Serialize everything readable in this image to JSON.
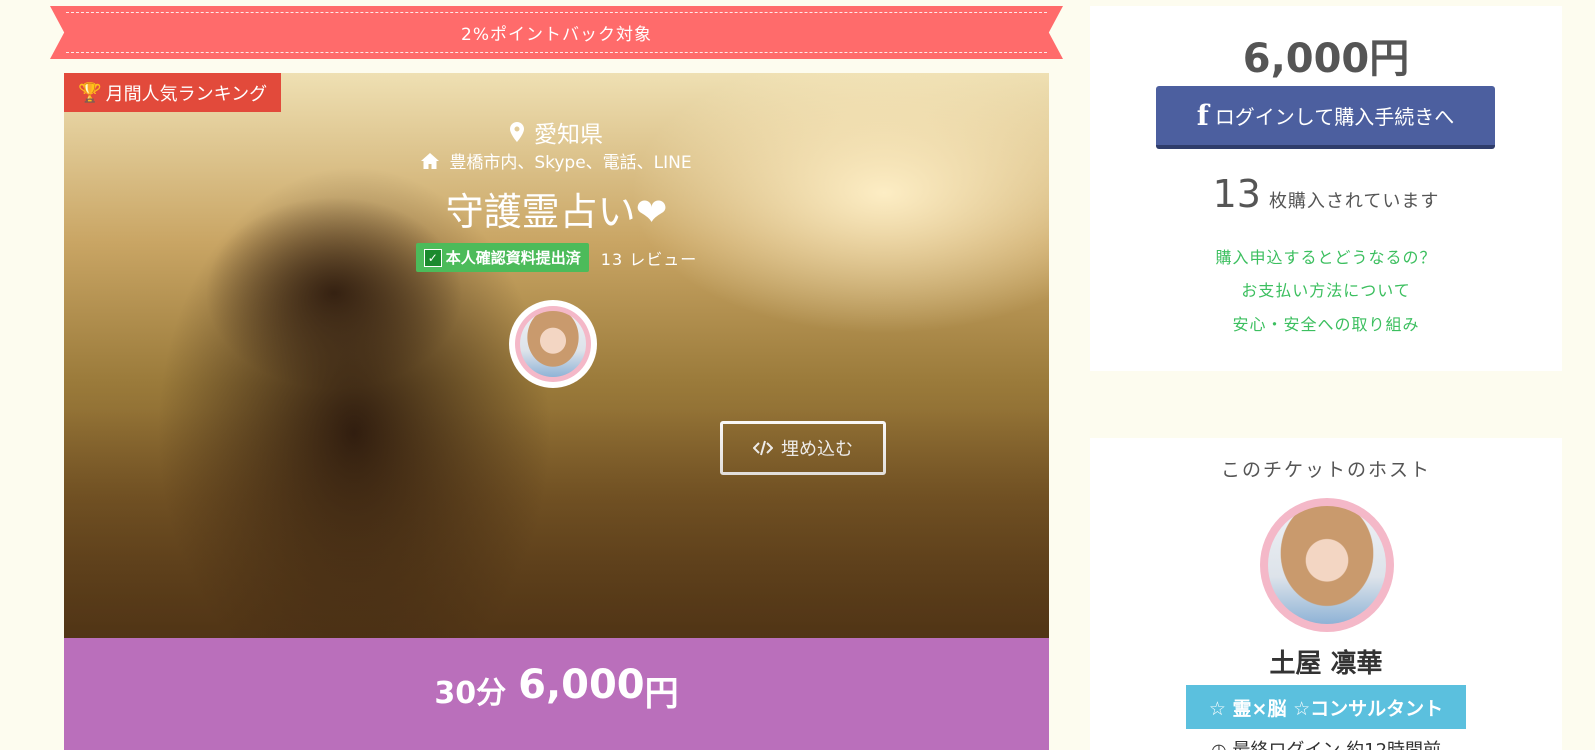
{
  "ribbon": {
    "text": "2%ポイントバック対象"
  },
  "hero": {
    "ranking_badge": "月間人気ランキング",
    "prefecture": "愛知県",
    "locations": "豊橋市内、Skype、電話、LINE",
    "title": "守護霊占い❤",
    "verified_badge": "本人確認資料提出済",
    "reviews": "13 レビュー",
    "embed_button": "埋め込む"
  },
  "price_bar": {
    "duration": "30分",
    "amount": "6,000",
    "currency": "円"
  },
  "buy_panel": {
    "price": "6,000円",
    "login_button": "ログインして購入手続きへ",
    "sold_count": "13",
    "sold_text": "枚購入されています",
    "links": [
      "購入申込するとどうなるの？",
      "お支払い方法について",
      "安心・安全への取り組み"
    ]
  },
  "host_panel": {
    "heading": "このチケットのホスト",
    "name": "土屋 凛華",
    "tag": "☆ 霊×脳 ☆コンサルタント",
    "last_login": "最終ログイン 約12時間前"
  },
  "colors": {
    "ribbon": "#ff6b6b",
    "ranking": "#e24a3b",
    "verified": "#4cbb5a",
    "price_bar": "#ba6fbb",
    "facebook": "#4c5f9f",
    "link_green": "#3cbf5f",
    "host_tag": "#5bc0de"
  },
  "icons": [
    "trophy-icon",
    "map-pin-icon",
    "home-icon",
    "check-icon",
    "code-icon",
    "facebook-icon",
    "clock-icon"
  ]
}
